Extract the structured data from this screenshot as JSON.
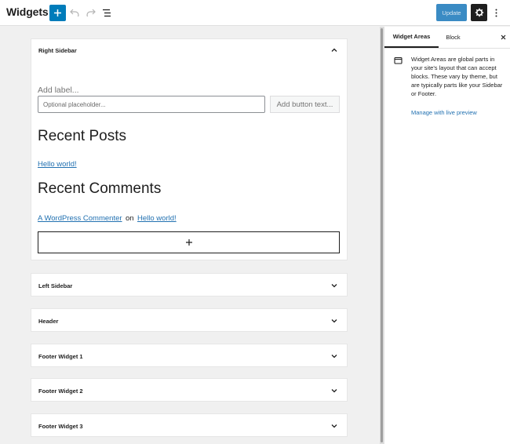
{
  "header": {
    "title": "Widgets",
    "update_label": "Update"
  },
  "editor": {
    "panels": [
      {
        "title": "Right Sidebar",
        "expanded": true
      },
      {
        "title": "Left Sidebar",
        "expanded": false
      },
      {
        "title": "Header",
        "expanded": false
      },
      {
        "title": "Footer Widget 1",
        "expanded": false
      },
      {
        "title": "Footer Widget 2",
        "expanded": false
      },
      {
        "title": "Footer Widget 3",
        "expanded": false
      }
    ],
    "search_block": {
      "label_placeholder": "Add label...",
      "input_placeholder": "Optional placeholder...",
      "button_placeholder": "Add button text..."
    },
    "recent_posts": {
      "heading": "Recent Posts",
      "link": "Hello world!"
    },
    "recent_comments": {
      "heading": "Recent Comments",
      "author": "A WordPress Commenter",
      "connector": "on",
      "post": "Hello world!"
    }
  },
  "sidebar": {
    "tabs": [
      {
        "label": "Widget Areas",
        "active": true
      },
      {
        "label": "Block",
        "active": false
      }
    ],
    "description": "Widget Areas are global parts in your site's layout that can accept blocks. These vary by theme, but are typically parts like your Sidebar or Footer.",
    "manage_link": "Manage with live preview"
  },
  "colors": {
    "accent": "#007cba",
    "link": "#2271b1",
    "dark": "#1e1e1e"
  },
  "icons": [
    "plus-icon",
    "undo-icon",
    "redo-icon",
    "list-view-icon",
    "gear-icon",
    "more-vertical-icon",
    "chevron-up-icon",
    "chevron-down-icon",
    "close-icon",
    "widget-area-icon"
  ]
}
